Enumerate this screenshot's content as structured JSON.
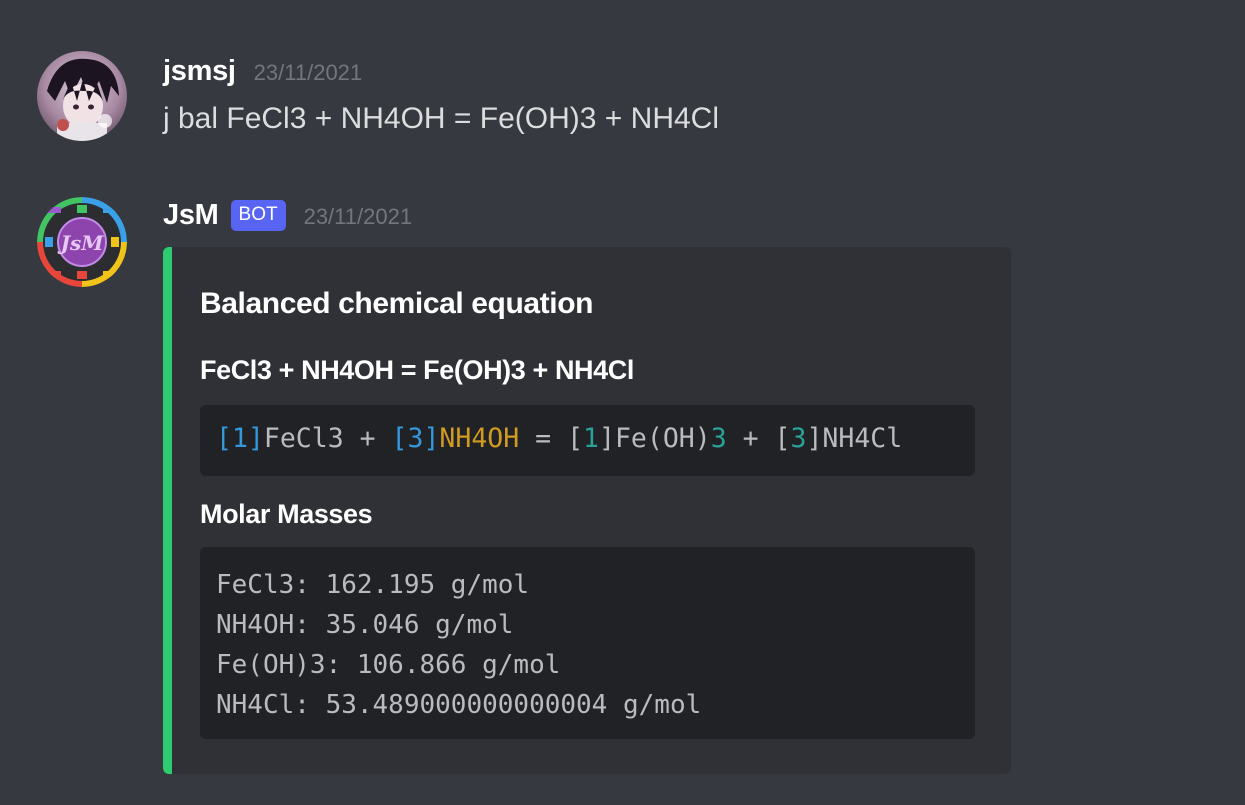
{
  "messages": [
    {
      "username": "jsmsj",
      "timestamp": "23/11/2021",
      "content": "j bal FeCl3 + NH4OH = Fe(OH)3 + NH4Cl"
    },
    {
      "username": "JsM",
      "bot_tag": "BOT",
      "timestamp": "23/11/2021",
      "embed": {
        "accent_color": "#2ecc71",
        "title": "Balanced chemical equation",
        "equation_field_name": "FeCl3 + NH4OH = Fe(OH)3 + NH4Cl",
        "equation_parts": {
          "b1_open": "[",
          "b1_num": "1]",
          "r1": "FeCl3 + ",
          "b2_open": "[",
          "b2_num": "3]",
          "r2": "NH4OH",
          "eq": " = [",
          "p1_num": "1",
          "p1_close": "]Fe(OH)",
          "p1_sub": "3",
          "plus2": " + [",
          "p2_num": "3",
          "p2_rest": "]NH4Cl"
        },
        "molar_masses_field_name": "Molar Masses",
        "molar_masses": [
          "FeCl3: 162.195 g/mol",
          "NH4OH: 35.046 g/mol",
          "Fe(OH)3: 106.866 g/mol",
          "NH4Cl: 53.489000000000004 g/mol"
        ]
      }
    }
  ],
  "icons": {
    "user_avatar": "anime-character-avatar-icon",
    "bot_avatar": "jsm-bot-logo-icon"
  },
  "colors": {
    "background": "#36393f",
    "embed_background": "#2f3136",
    "code_background": "#202225",
    "bot_tag": "#5865f2"
  }
}
